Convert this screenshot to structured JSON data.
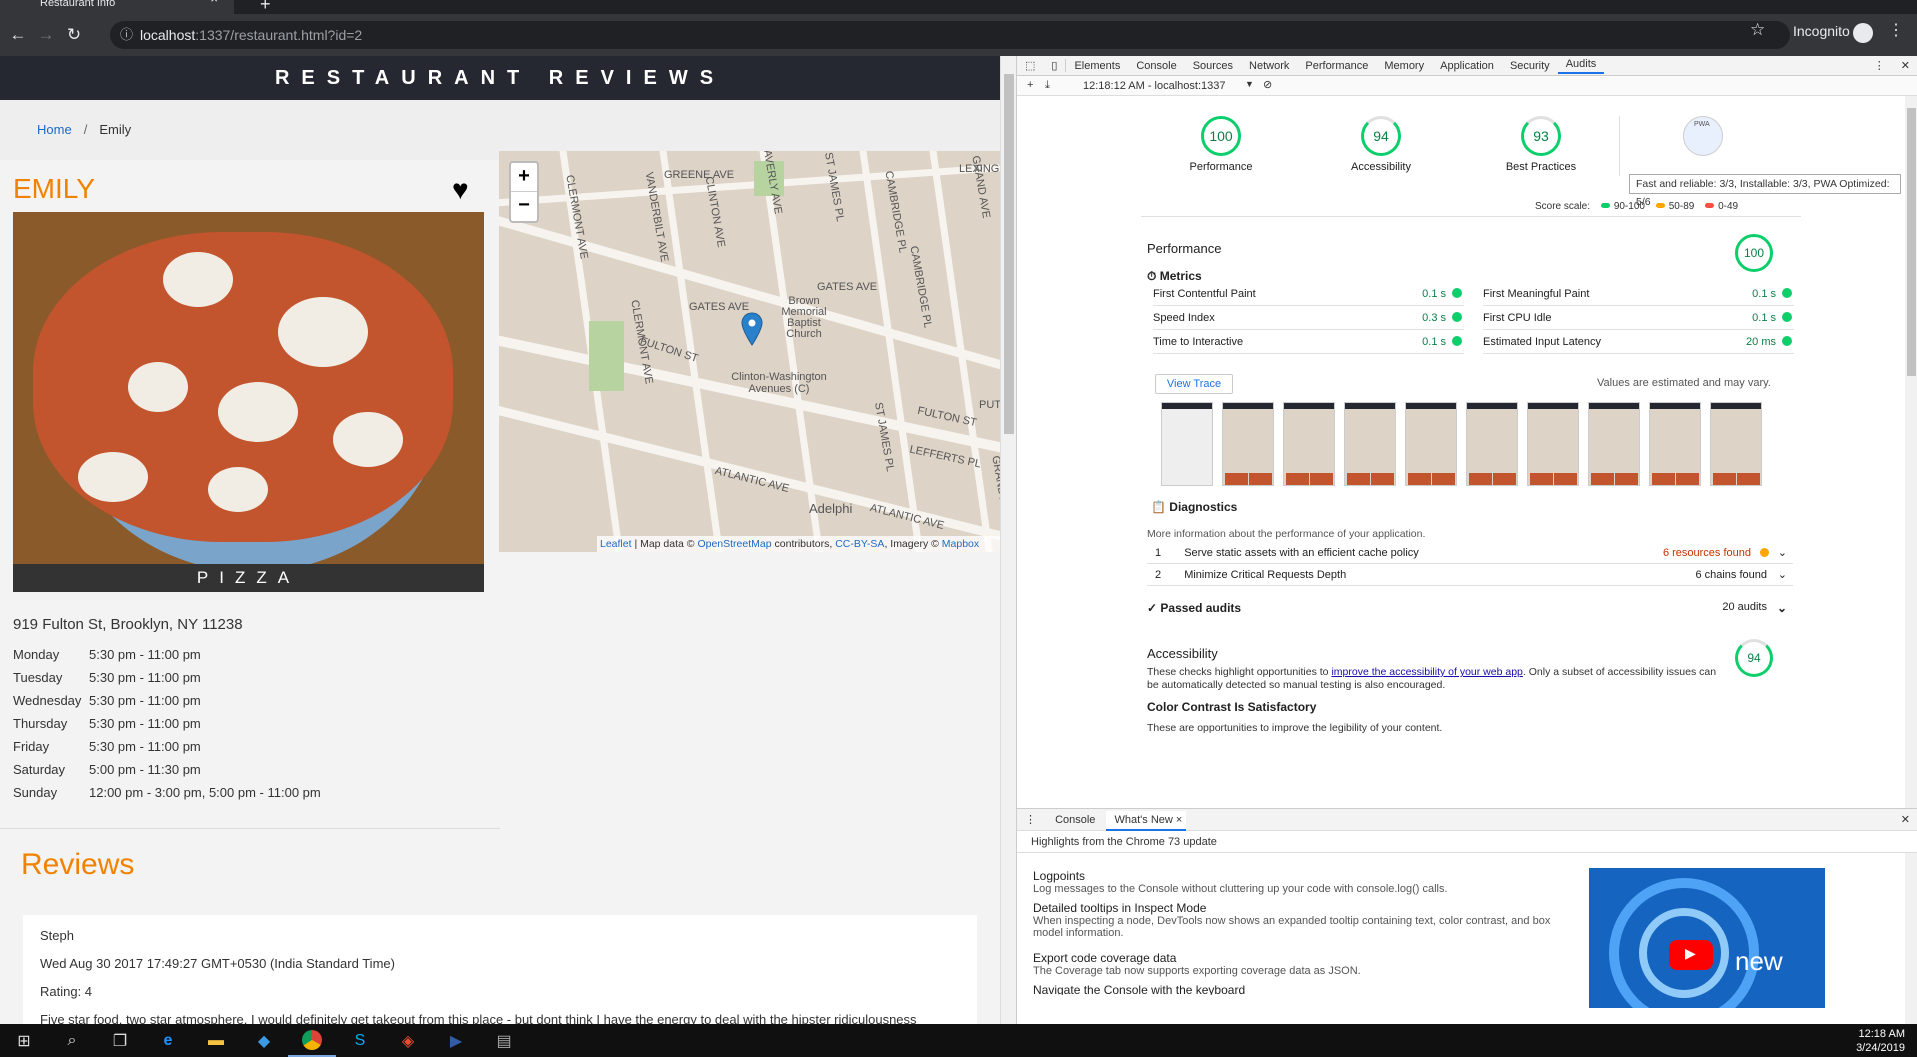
{
  "browser": {
    "tab_title": "Restaurant Info",
    "url_host": "localhost",
    "url_path": ":1337/restaurant.html?id=2",
    "incognito_label": "Incognito"
  },
  "site": {
    "header": "RESTAURANT REVIEWS",
    "breadcrumb": {
      "home": "Home",
      "current": "Emily"
    },
    "restaurant_name": "EMILY",
    "cuisine": "PIZZA",
    "address": "919 Fulton St, Brooklyn, NY 11238",
    "hours": [
      {
        "day": "Monday",
        "time": "5:30 pm - 11:00 pm"
      },
      {
        "day": "Tuesday",
        "time": "5:30 pm - 11:00 pm"
      },
      {
        "day": "Wednesday",
        "time": "5:30 pm - 11:00 pm"
      },
      {
        "day": "Thursday",
        "time": "5:30 pm - 11:00 pm"
      },
      {
        "day": "Friday",
        "time": "5:30 pm - 11:00 pm"
      },
      {
        "day": "Saturday",
        "time": "5:00 pm - 11:30 pm"
      },
      {
        "day": "Sunday",
        "time": "12:00 pm - 3:00 pm, 5:00 pm - 11:00 pm"
      }
    ],
    "reviews_title": "Reviews",
    "review": {
      "name": "Steph",
      "date": "Wed Aug 30 2017 17:49:27 GMT+0530 (India Standard Time)",
      "rating": "Rating: 4",
      "comments": "Five star food, two star atmosphere. I would definitely get takeout from this place - but dont think I have the energy to deal with the hipster ridiculousness"
    },
    "map": {
      "zoom_in": "+",
      "zoom_out": "−",
      "labels": [
        "GREENE AVE",
        "GATES AVE",
        "GATES AVE",
        "FULTON ST",
        "FULTON ST",
        "ATLANTIC AVE",
        "ATLANTIC AVE",
        "CLERMONT AVE",
        "CLERMONT AVE",
        "VANDERBILT AVE",
        "CLINTON AVE",
        "WAVERLY AVE",
        "ST JAMES PL",
        "ST JAMES PL",
        "CAMBRIDGE PL",
        "CAMBRIDGE PL",
        "GRAND AVE",
        "GRAND AVE",
        "LEFFERTS PL",
        "LEXINGTON",
        "Brown Memorial Baptist Church",
        "Clinton-Washington Avenues (C)",
        "Adelphi",
        "PUT"
      ],
      "attrib_leaflet": "Leaflet",
      "attrib_text1": " | Map data © ",
      "attrib_osm": "OpenStreetMap",
      "attrib_text2": " contributors, ",
      "attrib_cc": "CC-BY-SA",
      "attrib_text3": ", Imagery © ",
      "attrib_mapbox": "Mapbox"
    }
  },
  "devtools": {
    "tabs": [
      "Elements",
      "Console",
      "Sources",
      "Network",
      "Performance",
      "Memory",
      "Application",
      "Security",
      "Audits"
    ],
    "active_tab": "Audits",
    "report_selector": "12:18:12 AM - localhost:1337",
    "scores": [
      {
        "label": "Performance",
        "value": "100"
      },
      {
        "label": "Accessibility",
        "value": "94"
      },
      {
        "label": "Best Practices",
        "value": "93"
      }
    ],
    "pwa_badge": "PWA",
    "tooltip": "Fast and reliable: 3/3, Installable: 3/3, PWA Optimized: 5/6",
    "score_scale": {
      "label": "Score scale:",
      "good": "90-100",
      "average": "50-89",
      "poor": "0-49"
    },
    "performance": {
      "title": "Performance",
      "score": "100",
      "metrics_title": "Metrics",
      "metrics": [
        {
          "name": "First Contentful Paint",
          "value": "0.1 s"
        },
        {
          "name": "First Meaningful Paint",
          "value": "0.1 s"
        },
        {
          "name": "Speed Index",
          "value": "0.3 s"
        },
        {
          "name": "First CPU Idle",
          "value": "0.1 s"
        },
        {
          "name": "Time to Interactive",
          "value": "0.1 s"
        },
        {
          "name": "Estimated Input Latency",
          "value": "20 ms"
        }
      ],
      "view_trace": "View Trace",
      "estimate_note": "Values are estimated and may vary.",
      "diagnostics_title": "Diagnostics",
      "diagnostics_desc": "More information about the performance of your application.",
      "diagnostics": [
        {
          "num": "1",
          "name": "Serve static assets with an efficient cache policy",
          "value": "6 resources found"
        },
        {
          "num": "2",
          "name": "Minimize Critical Requests Depth",
          "value": "6 chains found"
        }
      ],
      "passed_title": "Passed audits",
      "passed_count": "20 audits"
    },
    "accessibility": {
      "title": "Accessibility",
      "score": "94",
      "desc_pre": "These checks highlight opportunities to ",
      "desc_link": "improve the accessibility of your web app",
      "desc_post": ". Only a subset of accessibility issues can be automatically detected so manual testing is also encouraged.",
      "contrast_title": "Color Contrast Is Satisfactory",
      "contrast_desc": "These are opportunities to improve the legibility of your content."
    },
    "drawer": {
      "tabs": [
        "Console",
        "What's New"
      ],
      "header": "Highlights from the Chrome 73 update",
      "items": [
        {
          "title": "Logpoints",
          "desc": "Log messages to the Console without cluttering up your code with console.log() calls."
        },
        {
          "title": "Detailed tooltips in Inspect Mode",
          "desc": "When inspecting a node, DevTools now shows an expanded tooltip containing text, color contrast, and box model information."
        },
        {
          "title": "Export code coverage data",
          "desc": "The Coverage tab now supports exporting coverage data as JSON."
        },
        {
          "title": "Navigate the Console with the keyboard",
          "desc": ""
        }
      ],
      "video_text": "new"
    }
  },
  "taskbar": {
    "time": "12:18 AM",
    "date": "3/24/2019"
  },
  "colors": {
    "accent": "#f18200",
    "good": "#0cce6b",
    "average": "#ffa400",
    "poor": "#ff4e42"
  }
}
